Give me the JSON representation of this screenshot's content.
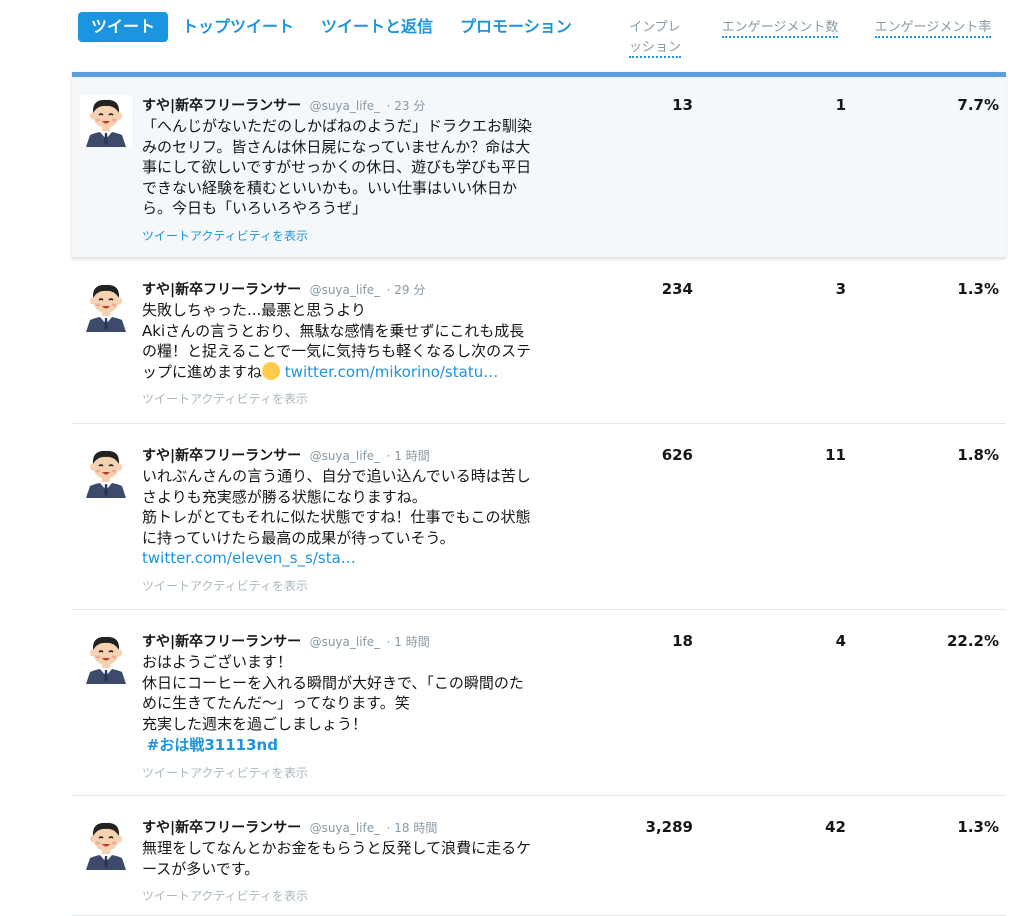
{
  "tabs": [
    {
      "label": "ツイート",
      "active": true
    },
    {
      "label": "トップツイート",
      "active": false
    },
    {
      "label": "ツイートと返信",
      "active": false
    },
    {
      "label": "プロモーション",
      "active": false
    }
  ],
  "columns": {
    "impressions_line1": "インプレ",
    "impressions_line2": "ッション",
    "engagements": "エンゲージメント数",
    "engagement_rate": "エンゲージメント率"
  },
  "activity_label": "ツイートアクティビティを表示",
  "colors": {
    "accent": "#1b95e0",
    "selected_bar": "#5c9ee0",
    "muted": "#8899a6"
  },
  "tweets": [
    {
      "name": "すや|新卒フリーランサー",
      "handle": "@suya_life_",
      "time": "· 23 分",
      "lines": [
        "「へんじがないただのしかばねのようだ」ドラクエお馴染",
        "みのセリフ。皆さんは休日屍になっていませんか？命は大",
        "事にして欲しいですがせっかくの休日、遊びも学びも平日",
        "できない経験を積むといいかも。いい仕事はいい休日か",
        "ら。今日も「いろいろやろうぜ」"
      ],
      "impressions": "13",
      "engagements": "1",
      "rate": "7.7%"
    },
    {
      "name": "すや|新卒フリーランサー",
      "handle": "@suya_life_",
      "time": "· 29 分",
      "lines": [
        "失敗しちゃった...最悪と思うより",
        "Akiさんの言うとおり、無駄な感情を乗せずにこれも成長",
        "の糧！と捉えることで一気に気持ちも軽くなるし次のステ",
        "ップに進めますね"
      ],
      "link": "twitter.com/mikorino/statu…",
      "impressions": "234",
      "engagements": "3",
      "rate": "1.3%"
    },
    {
      "name": "すや|新卒フリーランサー",
      "handle": "@suya_life_",
      "time": "· 1 時間",
      "lines": [
        "いれぶんさんの言う通り、自分で追い込んでいる時は苦し",
        "さよりも充実感が勝る状態になりますね。",
        "筋トレがとてもそれに似た状態ですね！仕事でもこの状態",
        "に持っていけたら最高の成果が待っていそう。"
      ],
      "link": "twitter.com/eleven_s_s/sta…",
      "impressions": "626",
      "engagements": "11",
      "rate": "1.8%"
    },
    {
      "name": "すや|新卒フリーランサー",
      "handle": "@suya_life_",
      "time": "· 1 時間",
      "lines": [
        "おはようございます！",
        "休日にコーヒーを入れる瞬間が大好きで、「この瞬間のた",
        "めに生きてたんだ〜」ってなります。笑",
        "充実した週末を過ごしましょう！"
      ],
      "hashtag": "#おは戦31113nd",
      "impressions": "18",
      "engagements": "4",
      "rate": "22.2%"
    },
    {
      "name": "すや|新卒フリーランサー",
      "handle": "@suya_life_",
      "time": "· 18 時間",
      "lines": [
        "無理をしてなんとかお金をもらうと反発して浪費に走るケ",
        "ースが多いです。"
      ],
      "impressions": "3,289",
      "engagements": "42",
      "rate": "1.3%"
    }
  ]
}
